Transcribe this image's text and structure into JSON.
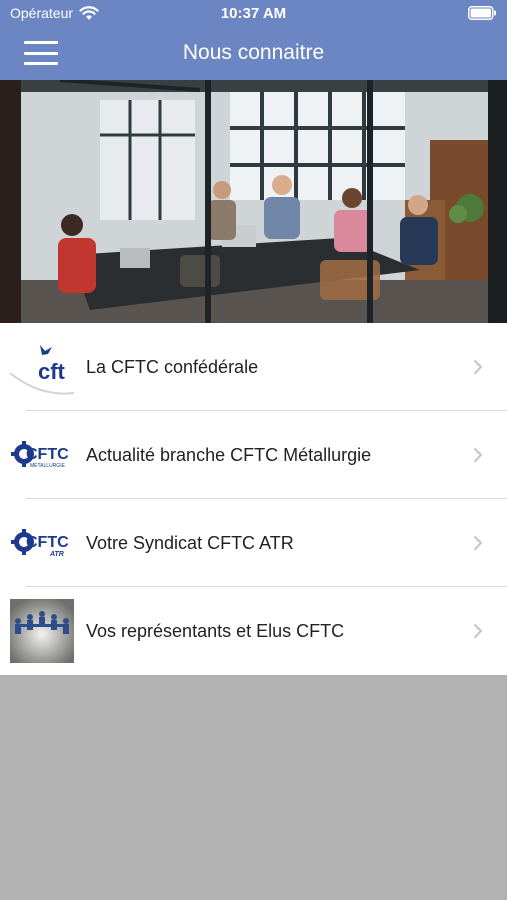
{
  "status_bar": {
    "carrier": "Opérateur",
    "time": "10:37 AM",
    "icons": [
      "wifi-icon",
      "battery-icon"
    ]
  },
  "nav": {
    "title": "Nous connaitre",
    "menu_icon": "hamburger-menu-icon"
  },
  "hero": {
    "description_icon": "meeting-room-photo"
  },
  "list": {
    "items": [
      {
        "label": "La CFTC confédérale",
        "thumbnail": "cftc-confederale-logo",
        "logo_text": "cft"
      },
      {
        "label": "Actualité branche CFTC Métallurgie",
        "thumbnail": "cftc-metallurgie-logo",
        "logo_text": "CFTC",
        "logo_sub": "MÉTALLURGIE"
      },
      {
        "label": "Votre Syndicat CFTC ATR",
        "thumbnail": "cftc-atr-logo",
        "logo_text": "CFTC",
        "logo_sub": "ATR"
      },
      {
        "label": "Vos représentants et Elus CFTC",
        "thumbnail": "paper-people-chain-photo"
      }
    ]
  },
  "colors": {
    "nav_background": "#6b86c3",
    "cftc_blue": "#1d3a8f",
    "page_background": "#b2b2b2"
  }
}
